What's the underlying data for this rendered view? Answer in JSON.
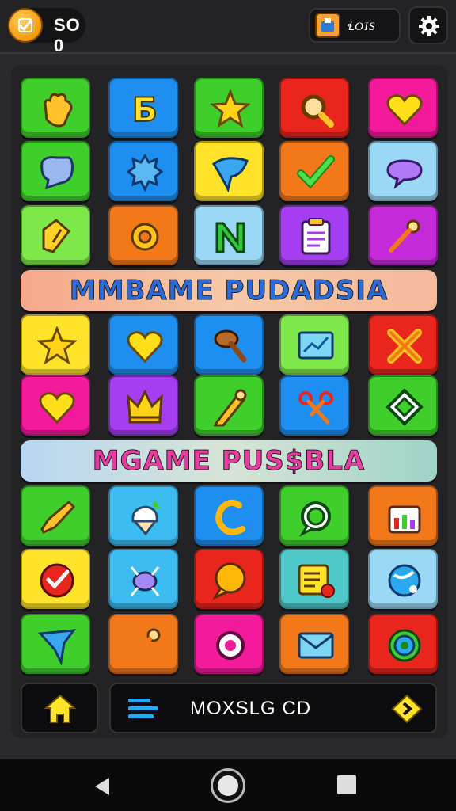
{
  "hud": {
    "coin_count": "SO 0",
    "tools_label": "ꞭOIS"
  },
  "banners": {
    "first": "MMBAME PUDADSIA",
    "second": "MGAME  PUS$BLA"
  },
  "bottom_bar": {
    "mode_label": "MOXSLG CD"
  },
  "colors": {
    "green": "#3fce2c",
    "blue": "#1e8ff0",
    "yellow": "#ffe22a",
    "red": "#e8261e",
    "pink": "#f41a9c",
    "orange": "#f2781a",
    "sky": "#9ad8f6",
    "purple": "#a53df0",
    "lime": "#7ee84a",
    "teal": "#4ec8c8"
  },
  "tiles": [
    {
      "color": "#3fce2c",
      "icon": "hand-icon"
    },
    {
      "color": "#1e8ff0",
      "icon": "letter-b-icon"
    },
    {
      "color": "#3fce2c",
      "icon": "star-icon"
    },
    {
      "color": "#e8261e",
      "icon": "magnifier-icon"
    },
    {
      "color": "#f41a9c",
      "icon": "heart-icon"
    },
    {
      "color": "#3fce2c",
      "icon": "chat-blob-icon"
    },
    {
      "color": "#1e8ff0",
      "icon": "splat-icon"
    },
    {
      "color": "#ffe22a",
      "icon": "wing-icon"
    },
    {
      "color": "#f2781a",
      "icon": "checkmark-icon"
    },
    {
      "color": "#9ad8f6",
      "icon": "speech-bubble-icon"
    },
    {
      "color": "#7ee84a",
      "icon": "tag-icon"
    },
    {
      "color": "#f2781a",
      "icon": "gear-splat-icon"
    },
    {
      "color": "#9ad8f6",
      "icon": "letter-n-icon"
    },
    {
      "color": "#a53df0",
      "icon": "clipboard-icon"
    },
    {
      "color": "#c52ad8",
      "icon": "pin-icon"
    },
    {
      "color": "#ffe22a",
      "icon": "star-icon"
    },
    {
      "color": "#1e8ff0",
      "icon": "heart-icon"
    },
    {
      "color": "#1e8ff0",
      "icon": "hammer-icon"
    },
    {
      "color": "#7ee84a",
      "icon": "chart-icon"
    },
    {
      "color": "#e8261e",
      "icon": "cross-icon"
    },
    {
      "color": "#f41a9c",
      "icon": "heart-icon"
    },
    {
      "color": "#a53df0",
      "icon": "crown-icon"
    },
    {
      "color": "#3fce2c",
      "icon": "pencil-icon"
    },
    {
      "color": "#1e8ff0",
      "icon": "scissors-icon"
    },
    {
      "color": "#3fce2c",
      "icon": "diamond-icon"
    },
    {
      "color": "#3fce2c",
      "icon": "horn-icon"
    },
    {
      "color": "#3cbcf0",
      "icon": "ice-cream-icon"
    },
    {
      "color": "#1e8ff0",
      "icon": "hook-icon"
    },
    {
      "color": "#3fce2c",
      "icon": "chat-ring-icon"
    },
    {
      "color": "#f2781a",
      "icon": "shop-icon"
    },
    {
      "color": "#ffe22a",
      "icon": "check-circle-icon"
    },
    {
      "color": "#3cbcf0",
      "icon": "bug-icon"
    },
    {
      "color": "#e8261e",
      "icon": "bubble-icon"
    },
    {
      "color": "#4ec8c8",
      "icon": "notepad-icon"
    },
    {
      "color": "#9ad8f6",
      "icon": "globe-icon"
    },
    {
      "color": "#3fce2c",
      "icon": "arrow-icon"
    },
    {
      "color": "#f2781a",
      "icon": "pin-icon"
    },
    {
      "color": "#f41a9c",
      "icon": "ring-icon"
    },
    {
      "color": "#f2781a",
      "icon": "envelope-icon"
    },
    {
      "color": "#e8261e",
      "icon": "target-icon"
    }
  ]
}
